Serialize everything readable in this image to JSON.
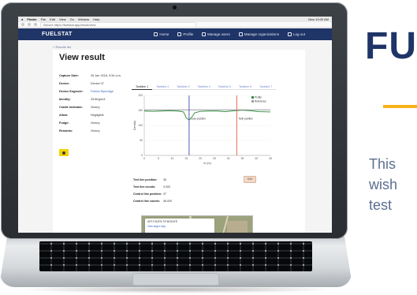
{
  "os_menu": {
    "app": "Finder",
    "items": [
      "File",
      "Edit",
      "View",
      "Go",
      "Window",
      "Help"
    ],
    "status": "Mon 10:00 AM"
  },
  "browser": {
    "url": "Secure  https://fuelstat.app/result/view"
  },
  "nav": {
    "logo": "FUELSTAT",
    "links": [
      "Home",
      "Profile",
      "Manage users",
      "Manage organizations",
      "Log out"
    ]
  },
  "breadcrumb": "< Results list",
  "page_title": "View result",
  "details": [
    {
      "label": "Capture Date:",
      "value": "26 Jan 2018, 9:34 a.m.",
      "link": false
    },
    {
      "label": "Device:",
      "value": "Device 07",
      "link": false
    },
    {
      "label": "Device Engineer:",
      "value": "Patrick Ripbridge",
      "link": true
    },
    {
      "label": "Identity:",
      "value": "25.8Kg/m3",
      "link": false
    },
    {
      "label": "Cradle indicator:",
      "value": "Victory",
      "link": false
    },
    {
      "label": "Allow:",
      "value": "Negligible",
      "link": false
    },
    {
      "label": "Fudge:",
      "value": "Victory",
      "link": false
    },
    {
      "label": "Remarks:",
      "value": "Victory",
      "link": false
    }
  ],
  "download_button": {
    "icon": "download-icon"
  },
  "chart_tabs": [
    "Tankline 1",
    "Tankline 2",
    "Tankline 3",
    "Tankline 4",
    "Tankline 5",
    "Tankline 6",
    "Tankline 7"
  ],
  "chart_data": {
    "type": "line",
    "title": "",
    "xlabel": "m (m)",
    "ylabel": "Density",
    "xlim": [
      0,
      45
    ],
    "ylim": [
      0,
      200
    ],
    "x_ticks": [
      0,
      5,
      10,
      15,
      20,
      25,
      30,
      35,
      40,
      45
    ],
    "y_ticks": [
      0,
      50,
      100,
      150,
      200
    ],
    "legend_position": "top-right",
    "series": [
      {
        "name": "Profile",
        "color": "#2e8b3a",
        "x": [
          0,
          3,
          6,
          9,
          12,
          14,
          15,
          16,
          17,
          18,
          20,
          23,
          26,
          29,
          32,
          35,
          38,
          41,
          45
        ],
        "y": [
          148,
          147,
          148,
          149,
          148,
          145,
          125,
          118,
          128,
          142,
          147,
          148,
          148,
          146,
          149,
          151,
          149,
          146,
          145
        ]
      },
      {
        "name": "Reference",
        "color": "#9aa0a6",
        "x": [
          0,
          45
        ],
        "y": [
          152,
          152
        ]
      }
    ],
    "markers": [
      {
        "label": "Lead position",
        "x": 16,
        "color": "#3a4aa8"
      },
      {
        "label": "Tank position",
        "x": 33,
        "color": "#e25b3a"
      }
    ]
  },
  "metrics": [
    {
      "label": "Test line position:",
      "value": "36"
    },
    {
      "label": "Test line counts:",
      "value": "3.000"
    },
    {
      "label": "Control line position:",
      "value": "37"
    },
    {
      "label": "Control line counts:",
      "value": "46.000"
    }
  ],
  "small_button": "Edit",
  "map": {
    "coordinates": "40°17'42.8\"N 74°46'15.6\"E",
    "link": "View larger map"
  },
  "side": {
    "headline": "FUELSTAT",
    "paragraph": [
      "This",
      "wish",
      "test"
    ],
    "accent_color": "#f7b21a"
  }
}
